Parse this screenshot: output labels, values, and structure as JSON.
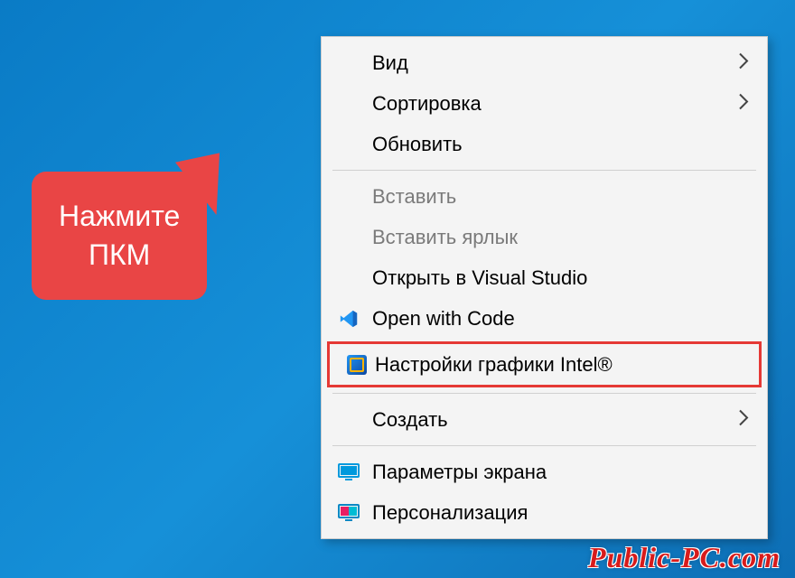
{
  "callout": {
    "line1": "Нажмите",
    "line2": "ПКМ"
  },
  "menu": {
    "view": "Вид",
    "sort": "Сортировка",
    "refresh": "Обновить",
    "paste": "Вставить",
    "paste_shortcut": "Вставить ярлык",
    "open_vs": "Открыть в Visual Studio",
    "open_code": "Open with Code",
    "intel_graphics": "Настройки графики Intel®",
    "create": "Создать",
    "display_settings": "Параметры экрана",
    "personalize": "Персонализация"
  },
  "watermark": "Public-PC.com"
}
